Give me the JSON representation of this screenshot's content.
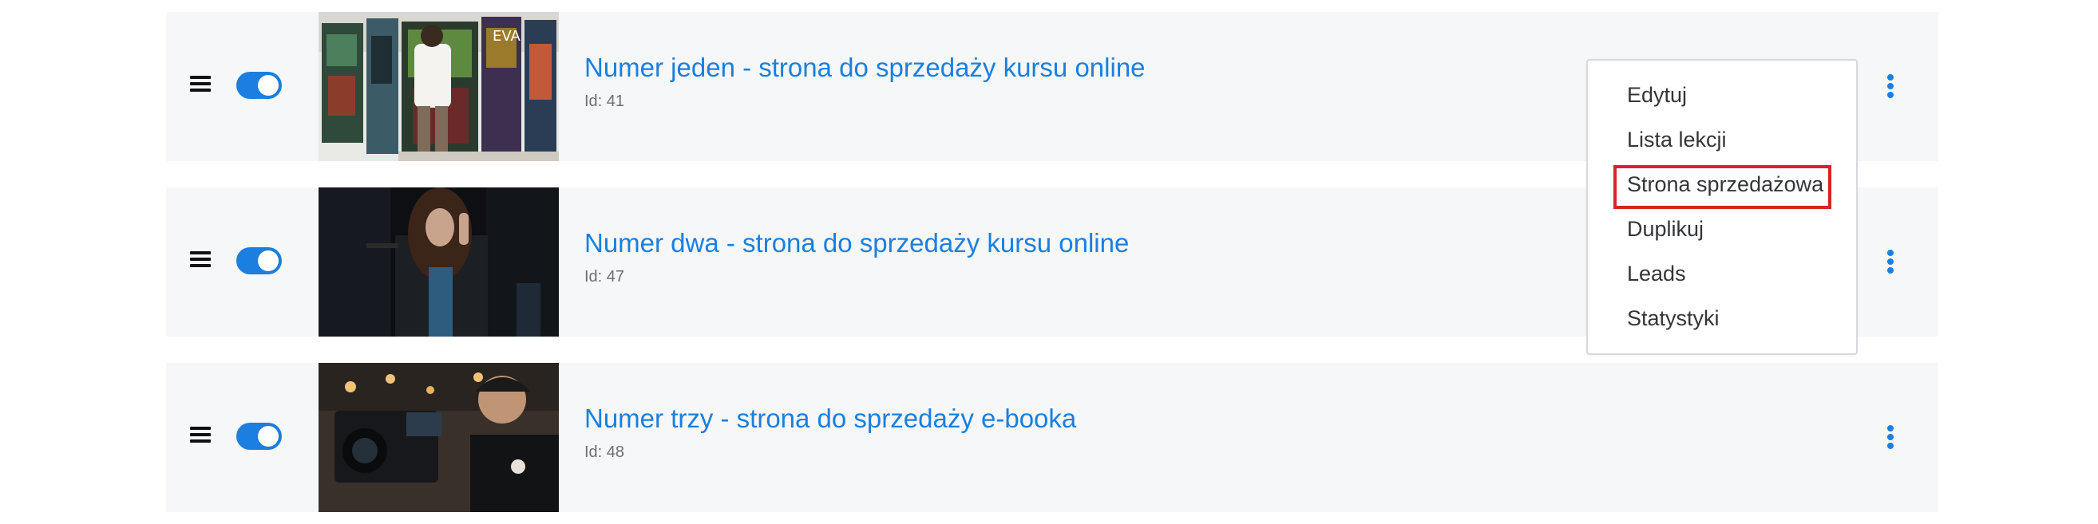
{
  "rows": [
    {
      "title": "Numer jeden - strona do sprzedaży kursu online",
      "id_label": "Id: 41",
      "thumbnail": "artist-painting-mural-photo",
      "enabled": true
    },
    {
      "title": "Numer dwa - strona do sprzedaży kursu online",
      "id_label": "Id: 47",
      "thumbnail": "singer-performing-photo",
      "enabled": true
    },
    {
      "title": "Numer trzy - strona do sprzedaży e-booka",
      "id_label": "Id: 48",
      "thumbnail": "camera-operator-photo",
      "enabled": true
    }
  ],
  "dropdown": {
    "items": [
      {
        "label": "Edytuj"
      },
      {
        "label": "Lista lekcji"
      },
      {
        "label": "Strona sprzedażowa",
        "highlighted": true
      },
      {
        "label": "Duplikuj"
      },
      {
        "label": "Leads"
      },
      {
        "label": "Statystyki"
      }
    ]
  },
  "icons": {
    "drag": "hamburger-drag-icon",
    "more": "vertical-ellipsis-icon"
  },
  "colors": {
    "accent": "#1a7fe0",
    "row_background": "#f6f7f9",
    "highlight": "#d6232a",
    "id_text": "#6b6f75",
    "menu_text": "#333538"
  }
}
